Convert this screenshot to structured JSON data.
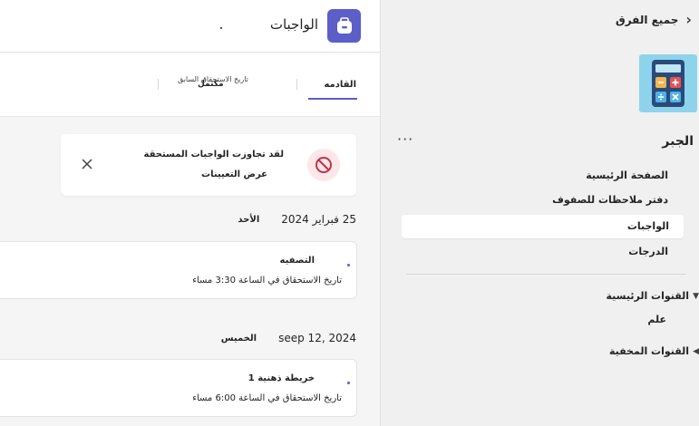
{
  "sidebar": {
    "all_teams": "جميع الفرق",
    "class_name": "الجبر",
    "more": "···",
    "nav": [
      {
        "label": "الصفحة الرئيسية"
      },
      {
        "label": "دفتر ملاحظات للصفوف"
      },
      {
        "label": "الواجبات",
        "active": true
      },
      {
        "label": "الدرجات"
      }
    ],
    "sections": {
      "main_channels": "القنوات الرئيسية",
      "general": "علم",
      "hidden_channels": "القنوات المخفية"
    }
  },
  "header": {
    "title": "الواجبات"
  },
  "tabs": {
    "upcoming": "القادمه",
    "past_due": "تاريخ الاستحقاق السابق",
    "completed": "مكتمل"
  },
  "alert": {
    "title": "لقد تجاوزت الواجبات المستحقة",
    "link": "عرض التعيينات"
  },
  "groups": [
    {
      "date": "25 فبراير 2024",
      "day": "الأحد",
      "assignment": {
        "title": "التصفيه",
        "due": "تاريخ الاستحقاق في الساعة 3:30 مساء"
      }
    },
    {
      "date": "seep 12, 2024",
      "day": "الخميس",
      "assignment": {
        "title": "خريطة ذهنية 1",
        "due": "تاريخ الاستحقاق في الساعة 6:00 مساء"
      }
    }
  ],
  "colors": {
    "brand": "#5b5fc7",
    "class_tile": "#8ed3ec",
    "alert_red": "#c4314b"
  }
}
